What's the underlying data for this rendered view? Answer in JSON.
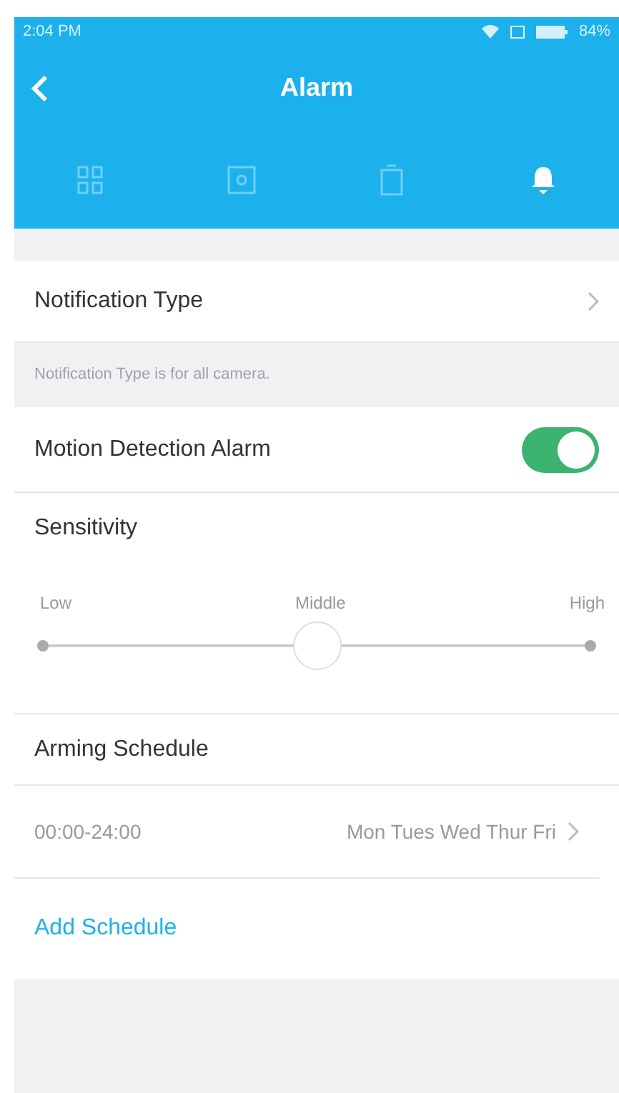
{
  "status_bar": {
    "time": "2:04 PM",
    "battery": "84%"
  },
  "header": {
    "title": "Alarm"
  },
  "tabs": [
    {
      "kind": "grid",
      "selected": false
    },
    {
      "kind": "square",
      "selected": false
    },
    {
      "kind": "card",
      "selected": false
    },
    {
      "kind": "bell",
      "selected": true
    }
  ],
  "notification_type": {
    "label": "Notification Type",
    "hint": "Notification Type is for all camera."
  },
  "motion_detection": {
    "label": "Motion Detection Alarm",
    "on": true
  },
  "sensitivity": {
    "label": "Sensitivity",
    "ticks": [
      "Low",
      "Middle",
      "High"
    ],
    "level": 0.5
  },
  "arming_schedule": {
    "label": "Arming Schedule",
    "schedules": [
      {
        "time": "00:00-24:00",
        "days": "Mon Tues Wed Thur Fri"
      }
    ],
    "add_label": "Add Schedule"
  }
}
